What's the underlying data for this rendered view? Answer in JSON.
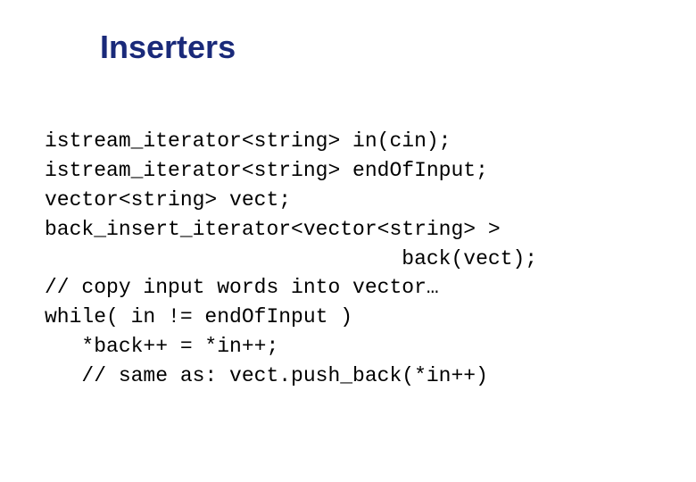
{
  "slide": {
    "title": "Inserters",
    "code": {
      "l1": "istream_iterator<string> in(cin);",
      "l2": "istream_iterator<string> endOfInput;",
      "l3": "vector<string> vect;",
      "l4": "back_insert_iterator<vector<string> >",
      "l5": "                             back(vect);",
      "l6": "// copy input words into vector…",
      "l7": "while( in != endOfInput )",
      "l8": "   *back++ = *in++;",
      "l9": "   // same as: vect.push_back(*in++)"
    }
  }
}
